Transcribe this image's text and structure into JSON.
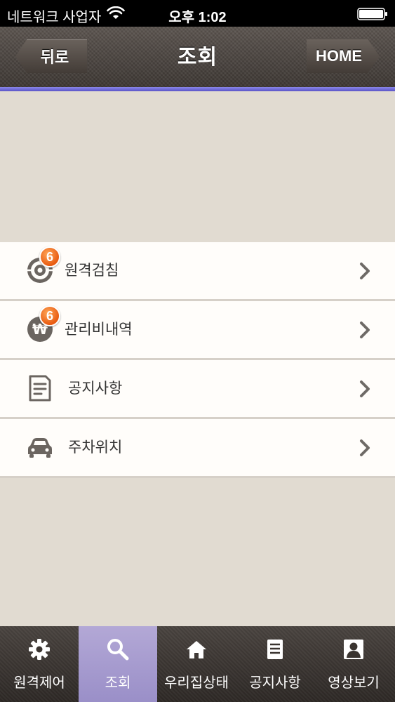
{
  "status": {
    "carrier": "네트워크 사업자",
    "time": "오후 1:02"
  },
  "nav": {
    "back_label": "뒤로",
    "title": "조회",
    "home_label": "HOME"
  },
  "list": {
    "items": [
      {
        "label": "원격검침",
        "icon": "meter-gauge-icon",
        "badge": "6"
      },
      {
        "label": "관리비내역",
        "icon": "won-coin-icon",
        "badge": "6"
      },
      {
        "label": "공지사항",
        "icon": "notice-document-icon",
        "badge": ""
      },
      {
        "label": "주차위치",
        "icon": "car-icon",
        "badge": ""
      }
    ]
  },
  "tabs": [
    {
      "label": "원격제어",
      "icon": "gear-icon",
      "selected": false
    },
    {
      "label": "조회",
      "icon": "search-icon",
      "selected": true
    },
    {
      "label": "우리집상태",
      "icon": "home-icon",
      "selected": false
    },
    {
      "label": "공지사항",
      "icon": "document-icon",
      "selected": false
    },
    {
      "label": "영상보기",
      "icon": "person-icon",
      "selected": false
    }
  ],
  "colors": {
    "accent": "#6a64d8",
    "badge": "#f07020",
    "tab_selected": "#a79cd0",
    "background": "#e1dbd1"
  }
}
